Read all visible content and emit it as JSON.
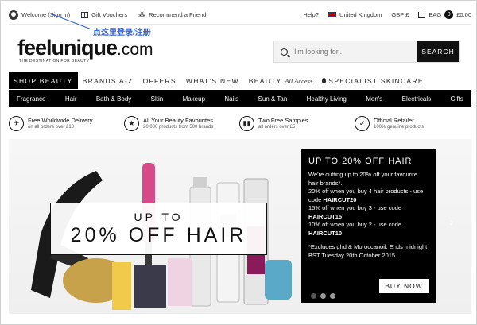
{
  "topbar": {
    "welcome": "Welcome (Sign in)",
    "gift": "Gift Vouchers",
    "refer": "Recommend a Friend",
    "help": "Help?",
    "country": "United Kingdom",
    "currency": "GBP £",
    "bag_label": "BAG",
    "bag_count": "0",
    "bag_total": "£0.00"
  },
  "annotation": "点这里登录/注册",
  "logo": {
    "name": "feelunique",
    "suffix": ".com",
    "tagline": "THE DESTINATION FOR BEAUTY"
  },
  "search": {
    "placeholder": "I'm looking for...",
    "button": "SEARCH"
  },
  "main_nav": [
    "SHOP BEAUTY",
    "BRANDS A-Z",
    "OFFERS",
    "WHAT'S NEW",
    "BEAUTY",
    "All Access",
    "SPECIALIST SKINCARE"
  ],
  "categories": [
    "Fragrance",
    "Hair",
    "Bath & Body",
    "Skin",
    "Makeup",
    "Nails",
    "Sun & Tan",
    "Healthy Living",
    "Men's",
    "Electricals",
    "Gifts"
  ],
  "benefits": [
    {
      "title": "Free Worldwide Delivery",
      "sub": "on all orders over £10"
    },
    {
      "title": "All Your Beauty Favourites",
      "sub": "20,000 products from 500 brands"
    },
    {
      "title": "Two Free Samples",
      "sub": "all orders over £5"
    },
    {
      "title": "Official Retailer",
      "sub": "100% genuine products"
    }
  ],
  "hero": {
    "promo_line1": "UP TO",
    "promo_line2": "20% OFF HAIR",
    "panel_title": "UP TO 20% OFF HAIR",
    "panel_intro": "We're cutting up to 20% off your favourite hair brands*.",
    "offer1": "20% off when you buy 4 hair products - use code ",
    "code1": "HAIRCUT20",
    "offer2": "15% off when you buy 3 - use code ",
    "code2": "HAIRCUT15",
    "offer3": "10% off when you buy 2 - use code ",
    "code3": "HAIRCUT10",
    "note": "*Excludes ghd & Moroccanoil. Ends midnight BST Tuesday 20th October 2015.",
    "button": "BUY NOW"
  },
  "colors": {
    "accent": "#000000",
    "annotation": "#2f5fd0"
  }
}
